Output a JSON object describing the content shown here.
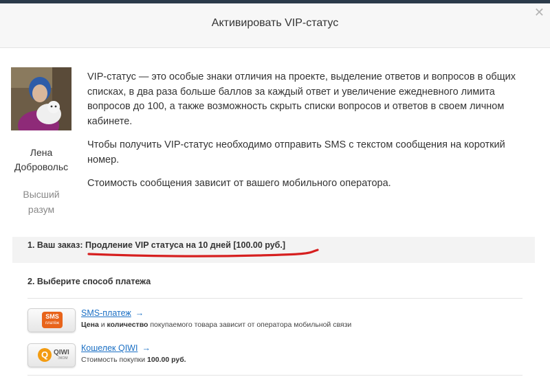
{
  "modal": {
    "title": "Активировать VIP-статус",
    "close_icon": "close-icon"
  },
  "user": {
    "name": "Лена\nДобровольс",
    "rank": "Высший\nразум"
  },
  "description": [
    "VIP-статус — это особые знаки отличия на проекте, выделение ответов и вопросов в общих списках, в два раза больше баллов за каждый ответ и увеличение ежедневного лимита вопросов до 100, а также возможность скрыть списки вопросов и ответов в своем личном кабинете.",
    "Чтобы получить VIP-статус необходимо отправить SMS с текстом сообщения на короткий номер.",
    "Стоимость сообщения зависит от вашего мобильного оператора."
  ],
  "order": {
    "label": "1. Ваш заказ:",
    "value": "Продление VIP статуса на 10 дней [100.00 руб.]"
  },
  "payment": {
    "title": "2. Выберите способ платежа",
    "methods": [
      {
        "logo_line1": "SMS",
        "logo_line2": "платёж",
        "link": "SMS-платеж",
        "arrow": "→",
        "note_b1": "Цена",
        "note_t1": " и ",
        "note_b2": "количество",
        "note_t2": " покупаемого товара зависит от оператора мобильной связи"
      },
      {
        "logo_mark": "Q",
        "logo_line1": "QIWI",
        "logo_line2": "ЭКОМ",
        "link": "Кошелек QIWI",
        "arrow": "→",
        "note_t1": "Стоимость покупки ",
        "note_b1": "100.00 руб."
      }
    ]
  },
  "colors": {
    "link": "#1a6fc4",
    "underline_annotation": "#d61f1f",
    "sms_brand": "#e8641b",
    "qiwi_brand": "#f39c12"
  }
}
